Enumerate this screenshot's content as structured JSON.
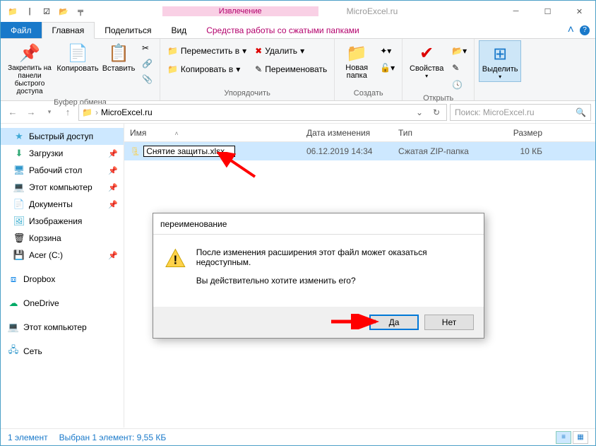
{
  "title": {
    "extract_tab": "Извлечение",
    "extract_sub": "Средства работы со сжатыми папками",
    "app_name": "MicroExcel.ru"
  },
  "ribbon_tabs": {
    "file": "Файл",
    "home": "Главная",
    "share": "Поделиться",
    "view": "Вид"
  },
  "ribbon": {
    "pin": "Закрепить на панели быстрого доступа",
    "copy": "Копировать",
    "paste": "Вставить",
    "clipboard": "Буфер обмена",
    "move_to": "Переместить в",
    "copy_to": "Копировать в",
    "delete": "Удалить",
    "rename": "Переименовать",
    "organize": "Упорядочить",
    "new_folder": "Новая папка",
    "create": "Создать",
    "properties": "Свойства",
    "open": "Открыть",
    "select": "Выделить"
  },
  "address": {
    "path": "MicroExcel.ru",
    "search_placeholder": "Поиск: MicroExcel.ru"
  },
  "sidebar": {
    "quick": "Быстрый доступ",
    "downloads": "Загрузки",
    "desktop": "Рабочий стол",
    "this_pc_short": "Этот компьютер",
    "documents": "Документы",
    "pictures": "Изображения",
    "recycle": "Корзина",
    "acer": "Acer (C:)",
    "dropbox": "Dropbox",
    "onedrive": "OneDrive",
    "this_pc": "Этот компьютер",
    "network": "Сеть"
  },
  "columns": {
    "name": "Имя",
    "date": "Дата изменения",
    "type": "Тип",
    "size": "Размер"
  },
  "file": {
    "name": "Снятие защиты.xlsx",
    "date": "06.12.2019 14:34",
    "type": "Сжатая ZIP-папка",
    "size": "10 КБ"
  },
  "dialog": {
    "title": "переименование",
    "line1": "После изменения расширения этот файл может оказаться недоступным.",
    "line2": "Вы действительно хотите изменить его?",
    "yes": "Да",
    "no": "Нет"
  },
  "status": {
    "count": "1 элемент",
    "selected": "Выбран 1 элемент: 9,55 КБ"
  }
}
